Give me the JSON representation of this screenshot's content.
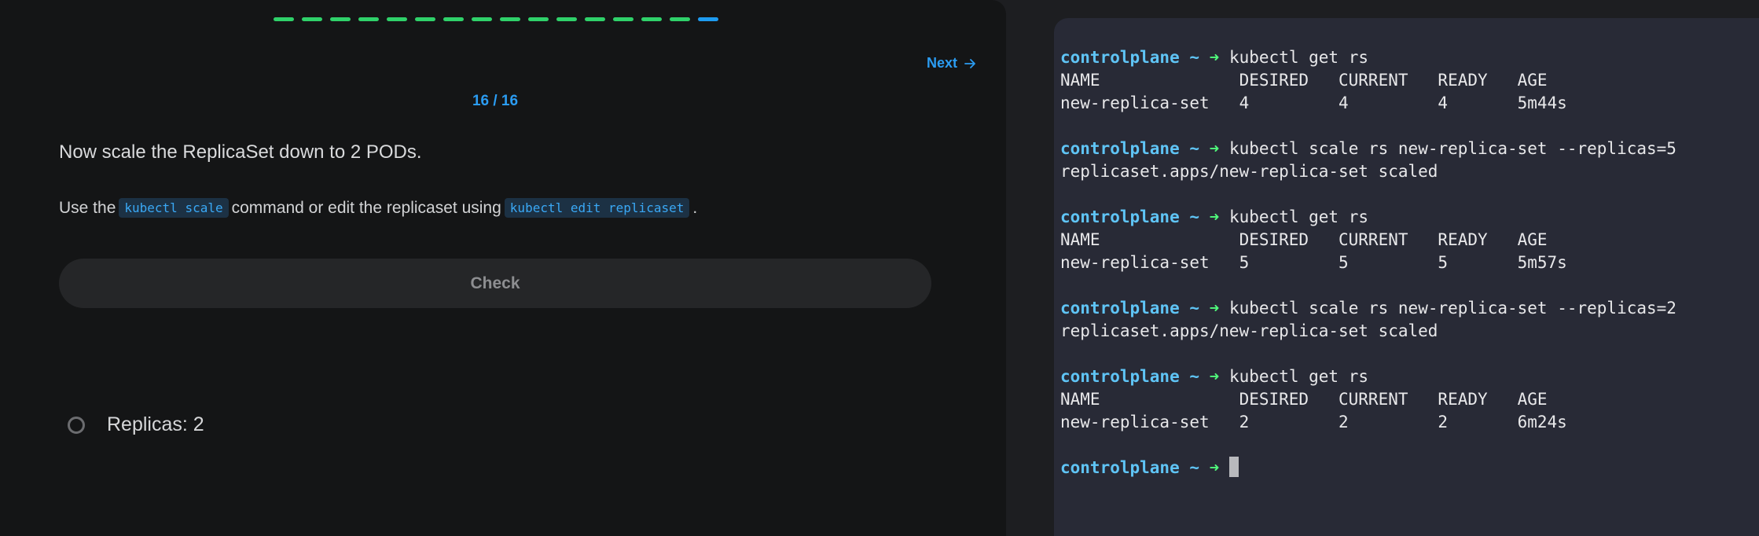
{
  "quiz": {
    "progress": {
      "total": 16,
      "completed": 15,
      "current": 16
    },
    "next_label": "Next",
    "counter": "16 / 16",
    "question": "Now scale the ReplicaSet down to 2 PODs.",
    "instruction": {
      "part1": "Use the",
      "code1": "kubectl scale",
      "part2": "command or edit the replicaset using",
      "code2": "kubectl edit replicaset",
      "part3": "."
    },
    "check_label": "Check",
    "task_label": "Replicas: 2"
  },
  "terminal": {
    "prompt_host": "controlplane ~",
    "prompt_arrow": "➜",
    "lines": [
      {
        "type": "cmd",
        "text": "kubectl get rs"
      },
      {
        "type": "out",
        "text": "NAME              DESIRED   CURRENT   READY   AGE"
      },
      {
        "type": "out",
        "text": "new-replica-set   4         4         4       5m44s"
      },
      {
        "type": "blank",
        "text": ""
      },
      {
        "type": "cmd",
        "text": "kubectl scale rs new-replica-set --replicas=5"
      },
      {
        "type": "out",
        "text": "replicaset.apps/new-replica-set scaled"
      },
      {
        "type": "blank",
        "text": ""
      },
      {
        "type": "cmd",
        "text": "kubectl get rs"
      },
      {
        "type": "out",
        "text": "NAME              DESIRED   CURRENT   READY   AGE"
      },
      {
        "type": "out",
        "text": "new-replica-set   5         5         5       5m57s"
      },
      {
        "type": "blank",
        "text": ""
      },
      {
        "type": "cmd",
        "text": "kubectl scale rs new-replica-set --replicas=2"
      },
      {
        "type": "out",
        "text": "replicaset.apps/new-replica-set scaled"
      },
      {
        "type": "blank",
        "text": ""
      },
      {
        "type": "cmd",
        "text": "kubectl get rs"
      },
      {
        "type": "out",
        "text": "NAME              DESIRED   CURRENT   READY   AGE"
      },
      {
        "type": "out",
        "text": "new-replica-set   2         2         2       6m24s"
      },
      {
        "type": "blank",
        "text": ""
      },
      {
        "type": "prompt",
        "text": ""
      }
    ]
  },
  "colors": {
    "progress_done": "#2fd16a",
    "progress_current": "#1e9bf0",
    "accent": "#2b9cf2",
    "prompt_host": "#5fc4f5",
    "prompt_arrow": "#50fa7b"
  },
  "icons": {
    "next": "arrow-right-icon",
    "task_status": "status-ring-icon"
  }
}
